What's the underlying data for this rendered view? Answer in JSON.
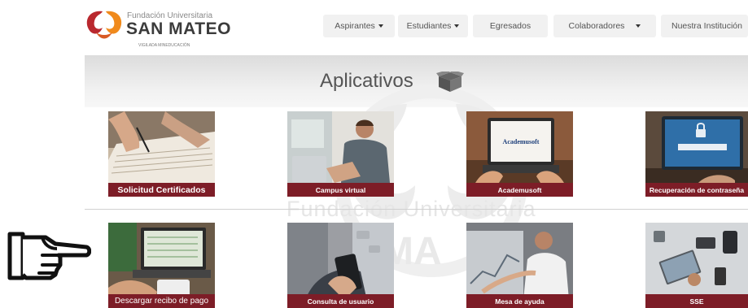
{
  "logo": {
    "line1": "Fundación Universitaria",
    "line2": "SAN MATEO",
    "tagline": "VIGILADA MINEDUCACIÓN"
  },
  "nav": {
    "items": [
      {
        "label": "Aspirantes"
      },
      {
        "label": "Estudiantes"
      },
      {
        "label": "Egresados"
      },
      {
        "label": "Colaboradores"
      },
      {
        "label": "Nuestra Institución"
      }
    ]
  },
  "section": {
    "title": "Aplicativos",
    "icon": "box-icon"
  },
  "watermark": {
    "line1": "Fundación Universitaria",
    "line2": "MA"
  },
  "tiles": [
    {
      "label": "Solicitud Certificados"
    },
    {
      "label": "Campus virtual"
    },
    {
      "label": "Academusoft",
      "screen_text": "Academusoft"
    },
    {
      "label": "Recuperación de contraseña"
    },
    {
      "label": "Descargar recibo de pago"
    },
    {
      "label": "Consulta de usuario"
    },
    {
      "label": "Mesa de ayuda"
    },
    {
      "label": "SSE"
    }
  ],
  "colors": {
    "label_bar": "#7d1d27",
    "logo_red": "#b9282e",
    "logo_orange": "#f08a1c"
  },
  "annotation": {
    "icon": "pointing-hand-icon"
  }
}
